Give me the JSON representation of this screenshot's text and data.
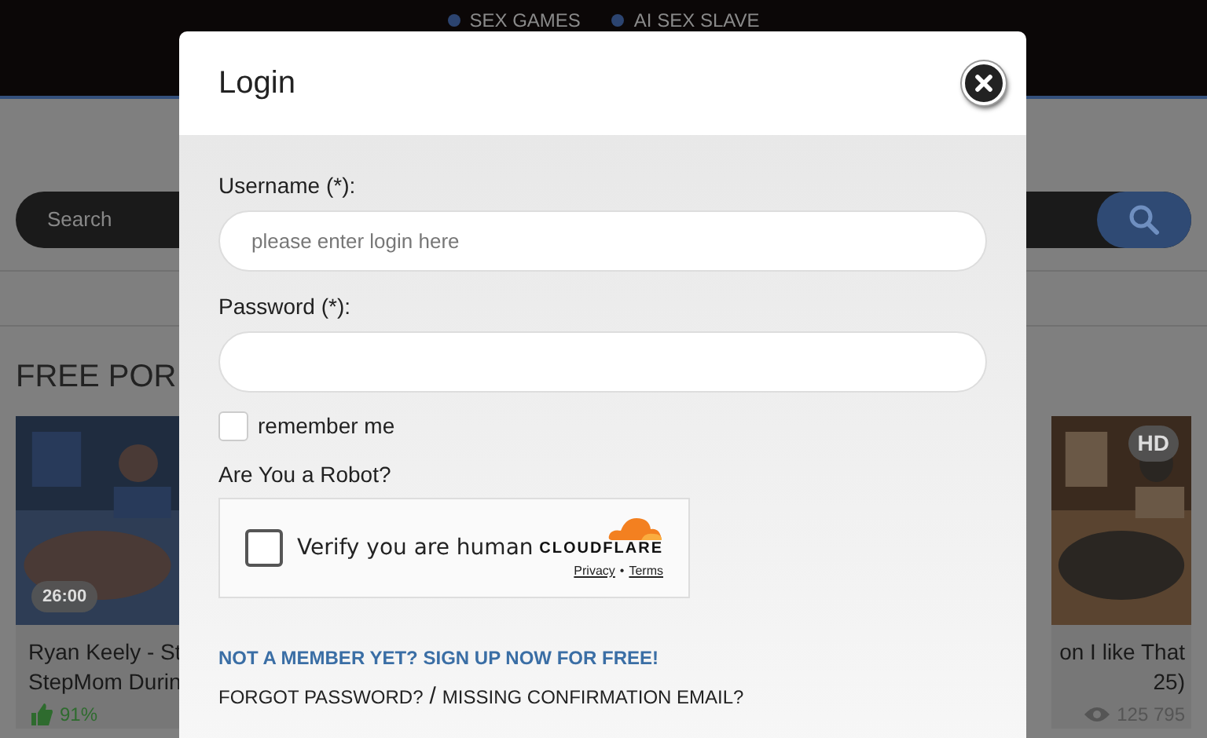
{
  "nav": [
    {
      "label": "SEX GAMES"
    },
    {
      "label": "AI SEX SLAVE"
    }
  ],
  "search": {
    "placeholder": "Search"
  },
  "section_title": "FREE POR",
  "videos": [
    {
      "title_lines": [
        "Ryan Keely - St",
        "StepMom Durin"
      ],
      "duration": "26:00",
      "rating": "91%"
    },
    {
      "title_lines": [
        "on I like That",
        "25)"
      ],
      "badge": "HD",
      "views": "125 795"
    }
  ],
  "login_dialog": {
    "title": "Login",
    "fields": [
      {
        "label": "Username (*):",
        "placeholder": "please enter login here"
      },
      {
        "label": "Password (*):"
      }
    ],
    "remember": {
      "label": "remember me",
      "checked": false
    },
    "captcha": {
      "question": "Are You a Robot?",
      "label": "Verify you are human",
      "checked": false,
      "brand": "CLOUDFLARE",
      "links": [
        "Privacy",
        "Terms"
      ],
      "link_separator": "•"
    },
    "signup_link": "NOT A MEMBER YET? SIGN UP NOW FOR FREE!",
    "forgot_link": "FORGOT PASSWORD?",
    "separator": "/",
    "missing_link": "MISSING CONFIRMATION EMAIL?"
  }
}
